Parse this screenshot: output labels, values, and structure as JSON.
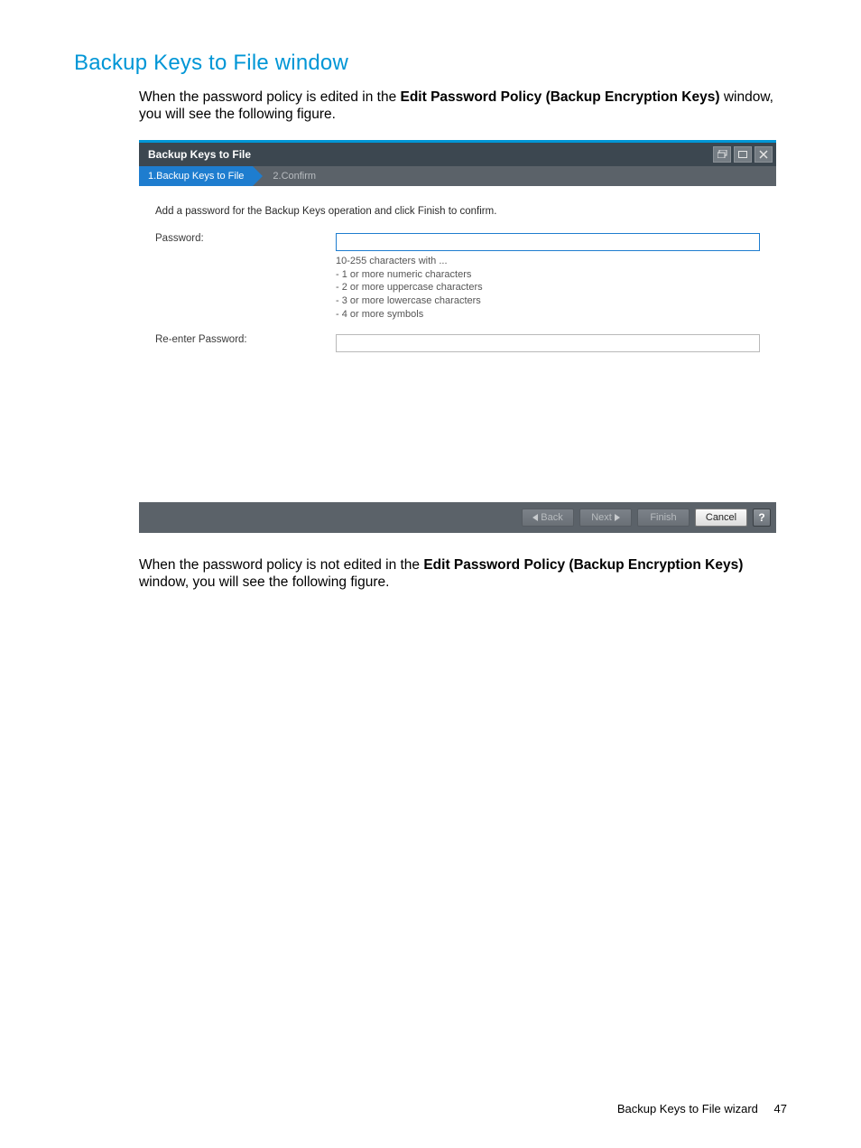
{
  "heading": "Backup Keys to File window",
  "intro": {
    "pre": "When the password policy is edited in the ",
    "bold": "Edit Password Policy (Backup Encryption Keys)",
    "post": " window, you will see the following figure."
  },
  "dialog": {
    "title": "Backup Keys to File",
    "steps": {
      "active": "1.Backup Keys to File",
      "inactive": "2.Confirm"
    },
    "instruction": "Add a password for the Backup Keys operation and click Finish to confirm.",
    "password_label": "Password:",
    "reenter_label": "Re-enter Password:",
    "password_value": "",
    "reenter_value": "",
    "hints": {
      "line1": "10-255 characters with ...",
      "line2": "- 1 or more numeric characters",
      "line3": "- 2 or more uppercase characters",
      "line4": "- 3 or more lowercase characters",
      "line5": "- 4 or more symbols"
    },
    "buttons": {
      "back": "Back",
      "next": "Next",
      "finish": "Finish",
      "cancel": "Cancel",
      "help": "?"
    }
  },
  "post": {
    "pre": "When the password policy is not edited in the ",
    "bold": "Edit Password Policy (Backup Encryption Keys)",
    "post": " window, you will see the following figure."
  },
  "footer": {
    "text": "Backup Keys to File wizard",
    "page": "47"
  }
}
